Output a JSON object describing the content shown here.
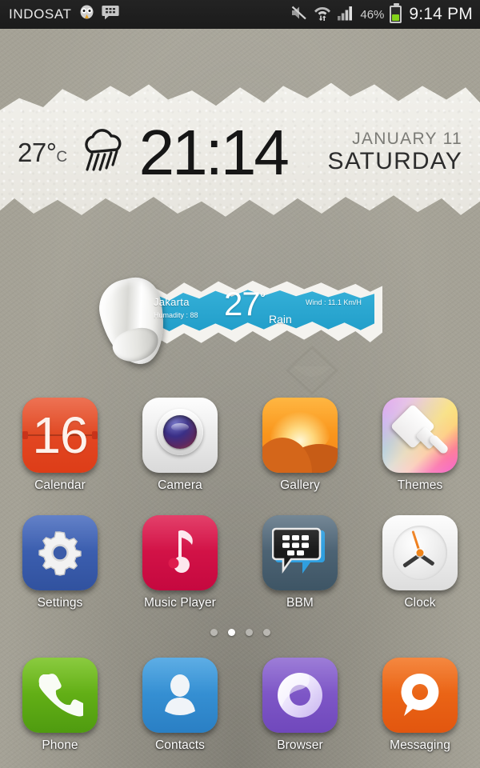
{
  "status_bar": {
    "carrier": "INDOSAT",
    "left_icons": [
      "twitter-bird-icon",
      "bbm-icon"
    ],
    "right_icons": [
      "mute-icon",
      "wifi-icon",
      "signal-icon"
    ],
    "battery_percent": "46%",
    "battery_level": 46,
    "clock": "9:14 PM"
  },
  "clock_widget": {
    "temperature": "27°",
    "unit": "C",
    "weather_icon": "rain-cloud-icon",
    "time": "21:14",
    "date_line1": "JANUARY 11",
    "date_line2": "SATURDAY"
  },
  "weather_widget": {
    "city": "Jakarta",
    "humidity": "Humadity : 88",
    "temperature": "27",
    "degree_symbol": "°",
    "condition": "Rain",
    "wind": "Wind : 11.1 Km/H",
    "accent_color": "#2aa8d4"
  },
  "rows": [
    {
      "apps": [
        {
          "label": "Calendar",
          "icon": "calendar-icon",
          "day": "16"
        },
        {
          "label": "Camera",
          "icon": "camera-icon"
        },
        {
          "label": "Gallery",
          "icon": "gallery-icon"
        },
        {
          "label": "Themes",
          "icon": "themes-icon"
        }
      ]
    },
    {
      "apps": [
        {
          "label": "Settings",
          "icon": "gear-icon"
        },
        {
          "label": "Music Player",
          "icon": "music-note-icon"
        },
        {
          "label": "BBM",
          "icon": "bbm-icon"
        },
        {
          "label": "Clock",
          "icon": "analog-clock-icon"
        }
      ]
    }
  ],
  "dock": {
    "apps": [
      {
        "label": "Phone",
        "icon": "phone-handset-icon"
      },
      {
        "label": "Contacts",
        "icon": "person-icon"
      },
      {
        "label": "Browser",
        "icon": "browser-swirl-icon"
      },
      {
        "label": "Messaging",
        "icon": "speech-bubble-icon"
      }
    ]
  },
  "page_indicator": {
    "total": 4,
    "active": 2
  }
}
